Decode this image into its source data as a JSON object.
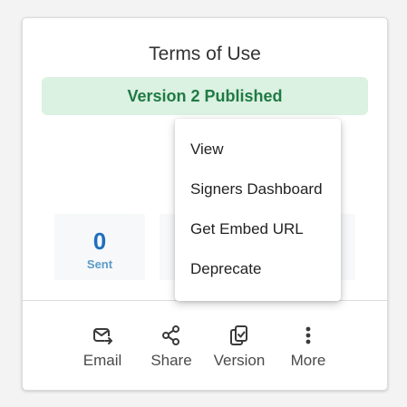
{
  "card": {
    "title": "Terms of Use",
    "status": "Version 2 Published",
    "colors": {
      "status_bg": "#dbf1e2",
      "status_text": "#1f7a44",
      "stat_value": "#1f6fbd",
      "stat_label": "#5a9cc9"
    }
  },
  "stats": [
    {
      "value": "0",
      "label": "Sent"
    }
  ],
  "actions": [
    {
      "label": "Email",
      "icon": "email-send-icon"
    },
    {
      "label": "Share",
      "icon": "share-icon"
    },
    {
      "label": "Version",
      "icon": "version-copy-icon"
    },
    {
      "label": "More",
      "icon": "more-vertical-icon"
    }
  ],
  "menu": {
    "items": [
      "View",
      "Signers Dashboard",
      "Get Embed URL",
      "Deprecate"
    ]
  }
}
